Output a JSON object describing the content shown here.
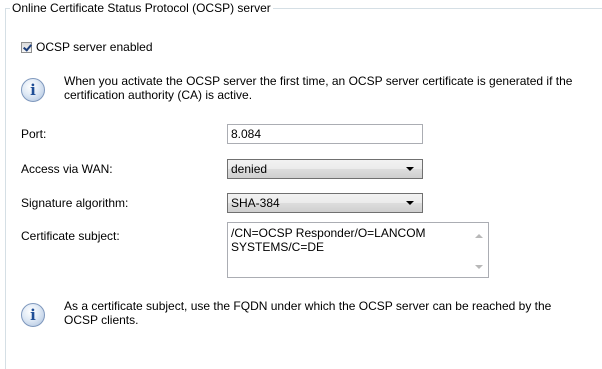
{
  "group": {
    "title": "Online Certificate Status Protocol (OCSP) server"
  },
  "ocsp_enabled": {
    "label": "OCSP server enabled",
    "checked": true
  },
  "info1": {
    "icon": "info-icon",
    "text": "When you activate the OCSP server the first time, an OCSP server certificate is generated if the certification authority (CA) is active."
  },
  "port": {
    "label": "Port:",
    "value": "8.084"
  },
  "access_wan": {
    "label": "Access via WAN:",
    "value": "denied"
  },
  "signature": {
    "label": "Signature algorithm:",
    "value": "SHA-384"
  },
  "cert_subject": {
    "label": "Certificate subject:",
    "value": "/CN=OCSP Responder/O=LANCOM SYSTEMS/C=DE"
  },
  "info2": {
    "icon": "info-icon",
    "text": "As a certificate subject, use the FQDN under which the OCSP server can be reached by the OCSP clients."
  }
}
